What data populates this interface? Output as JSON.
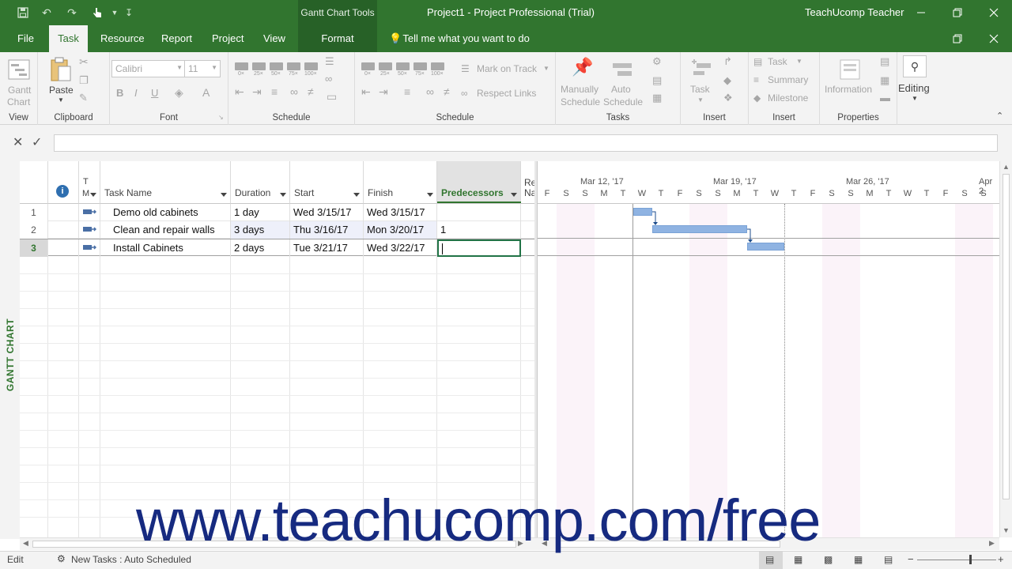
{
  "title_bar": {
    "tools_tab_header": "Gantt Chart Tools",
    "document_title": "Project1  -  Project Professional (Trial)",
    "user_name": "TeachUcomp Teacher"
  },
  "ribbon_tabs": {
    "file": "File",
    "task": "Task",
    "resource": "Resource",
    "report": "Report",
    "project": "Project",
    "view": "View",
    "format": "Format",
    "tell_me": "Tell me what you want to do"
  },
  "ribbon": {
    "view_group": {
      "gantt_chart_line1": "Gantt",
      "gantt_chart_line2": "Chart",
      "label": "View"
    },
    "clipboard_group": {
      "paste": "Paste",
      "label": "Clipboard"
    },
    "font_group": {
      "font_name": "Calibri",
      "font_size": "11",
      "bold": "B",
      "italic": "I",
      "underline": "U",
      "label": "Font"
    },
    "schedule_group_1": {
      "label": "Schedule",
      "pcts": [
        "0×",
        "25×",
        "50×",
        "75×",
        "100×"
      ]
    },
    "schedule_group_2": {
      "label": "Schedule",
      "mark_on_track": "Mark on Track",
      "respect_links": "Respect Links",
      "pcts": [
        "0×",
        "25×",
        "50×",
        "75×",
        "100×"
      ]
    },
    "tasks_group": {
      "manually_line1": "Manually",
      "manually_line2": "Schedule",
      "auto_line1": "Auto",
      "auto_line2": "Schedule",
      "label": "Tasks"
    },
    "insert_group_1": {
      "task": "Task",
      "label": "Insert"
    },
    "insert_group_2": {
      "task": "Task",
      "summary": "Summary",
      "milestone": "Milestone",
      "label": "Insert"
    },
    "properties_group": {
      "information": "Information",
      "label": "Properties"
    },
    "editing": "Editing"
  },
  "view_label": "GANTT CHART",
  "table": {
    "headers": {
      "info": "i",
      "mode_line1": "T",
      "mode_line2": "M",
      "task_name": "Task Name",
      "duration": "Duration",
      "start": "Start",
      "finish": "Finish",
      "predecessors": "Predecessors",
      "resource_line1": "Re",
      "resource_line2": "Na"
    },
    "rows": [
      {
        "id": "1",
        "name": "Demo old cabinets",
        "duration": "1 day",
        "start": "Wed 3/15/17",
        "finish": "Wed 3/15/17",
        "predecessors": ""
      },
      {
        "id": "2",
        "name": "Clean and repair walls",
        "duration": "3 days",
        "start": "Thu 3/16/17",
        "finish": "Mon 3/20/17",
        "predecessors": "1"
      },
      {
        "id": "3",
        "name": "Install Cabinets",
        "duration": "2 days",
        "start": "Tue 3/21/17",
        "finish": "Wed 3/22/17",
        "predecessors": ""
      }
    ]
  },
  "gantt": {
    "weeks": [
      "Mar 12, '17",
      "Mar 19, '17",
      "Mar 26, '17",
      "Apr 2"
    ],
    "days": [
      "F",
      "S",
      "S",
      "M",
      "T",
      "W",
      "T",
      "F",
      "S",
      "S",
      "M",
      "T",
      "W",
      "T",
      "F",
      "S",
      "S",
      "M",
      "T",
      "W",
      "T",
      "F",
      "S",
      "S"
    ]
  },
  "status_bar": {
    "mode": "Edit",
    "new_tasks": "New Tasks : Auto Scheduled"
  },
  "watermark": "www.teachucomp.com/free",
  "colors": {
    "brand_green": "#31752f",
    "bar_blue": "#8fb3e2",
    "watermark_navy": "#162a80"
  }
}
